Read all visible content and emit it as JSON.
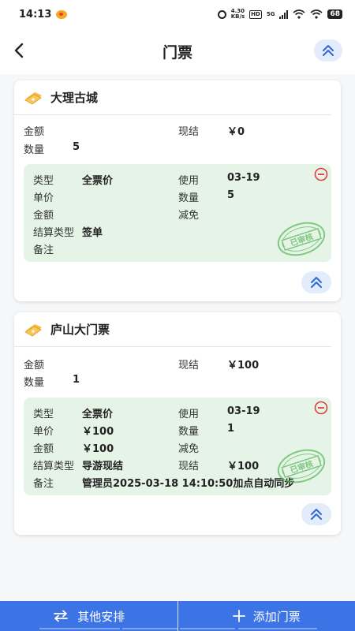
{
  "status_bar": {
    "time": "14:13",
    "speed_top": "4.30",
    "speed_bottom": "KB/s",
    "hd": "HD",
    "network": "5G",
    "battery": "68"
  },
  "header": {
    "title": "门票"
  },
  "labels": {
    "amount": "金额",
    "quantity": "数量",
    "settled": "现结",
    "type": "类型",
    "use": "使用",
    "unit_price": "单价",
    "discount": "减免",
    "settlement_type": "结算类型",
    "remark": "备注",
    "stamp_text": "已审核"
  },
  "tickets": [
    {
      "name": "大理古城",
      "amount": "",
      "settled": "￥0",
      "quantity": "5",
      "detail": {
        "type": "全票价",
        "use": "03-19",
        "unit_price": "",
        "quantity": "5",
        "amount": "",
        "discount": "",
        "settlement_type": "签单",
        "settled": "",
        "remark": ""
      }
    },
    {
      "name": "庐山大门票",
      "amount": "",
      "settled": "￥100",
      "quantity": "1",
      "detail": {
        "type": "全票价",
        "use": "03-19",
        "unit_price": "￥100",
        "quantity": "1",
        "amount": "￥100",
        "discount": "",
        "settlement_type": "导游现结",
        "settled": "￥100",
        "remark": "管理员2025-03-18 14:10:50加点自动同步"
      }
    }
  ],
  "bottom_bar": {
    "other_arrangements": "其他安排",
    "add_ticket": "添加门票"
  },
  "colors": {
    "accent": "#3c74e6",
    "detail_bg": "#e6f4e8",
    "stamp_green": "#5cb85c",
    "remove_red": "#e23c3c",
    "ticket_yellow": "#f5b942"
  }
}
